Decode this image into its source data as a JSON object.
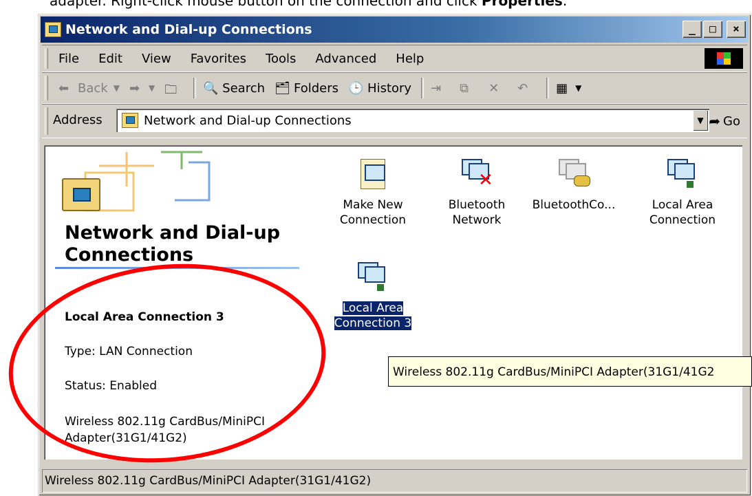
{
  "instruction": {
    "pre": "adapter. Right-click mouse button on the connection and click ",
    "bold": "Properties",
    "post": "."
  },
  "window": {
    "title": "Network and Dial-up Connections",
    "controls": [
      "_",
      "□",
      "×"
    ]
  },
  "menu": [
    "File",
    "Edit",
    "View",
    "Favorites",
    "Tools",
    "Advanced",
    "Help"
  ],
  "toolbar": {
    "back": "Back",
    "search": "Search",
    "folders": "Folders",
    "history": "History"
  },
  "address": {
    "label": "Address",
    "value": "Network and Dial-up Connections",
    "go": "Go"
  },
  "panel": {
    "title": "Network and Dial-up Connections",
    "selected_name": "Local Area Connection 3",
    "type": "Type: LAN Connection",
    "status": "Status: Enabled",
    "adapter": "Wireless 802.11g CardBus/MiniPCI Adapter(31G1/41G2)"
  },
  "icons": [
    {
      "line1": "Make New",
      "line2": "Connection"
    },
    {
      "line1": "Bluetooth",
      "line2": "Network"
    },
    {
      "line1": "BluetoothCo...",
      "line2": ""
    },
    {
      "line1": "Local Area",
      "line2": "Connection"
    },
    {
      "line1": "Local Area",
      "line2": "Connection 3"
    }
  ],
  "tooltip": "Wireless 802.11g CardBus/MiniPCI Adapter(31G1/41G2",
  "statusbar": "Wireless 802.11g CardBus/MiniPCI Adapter(31G1/41G2)",
  "colors": {
    "titlebar_start": "#0a246a",
    "titlebar_end": "#a6caf0",
    "selection": "#0a246a",
    "tooltip_bg": "#ffffe1",
    "annotation": "#ff0000"
  }
}
